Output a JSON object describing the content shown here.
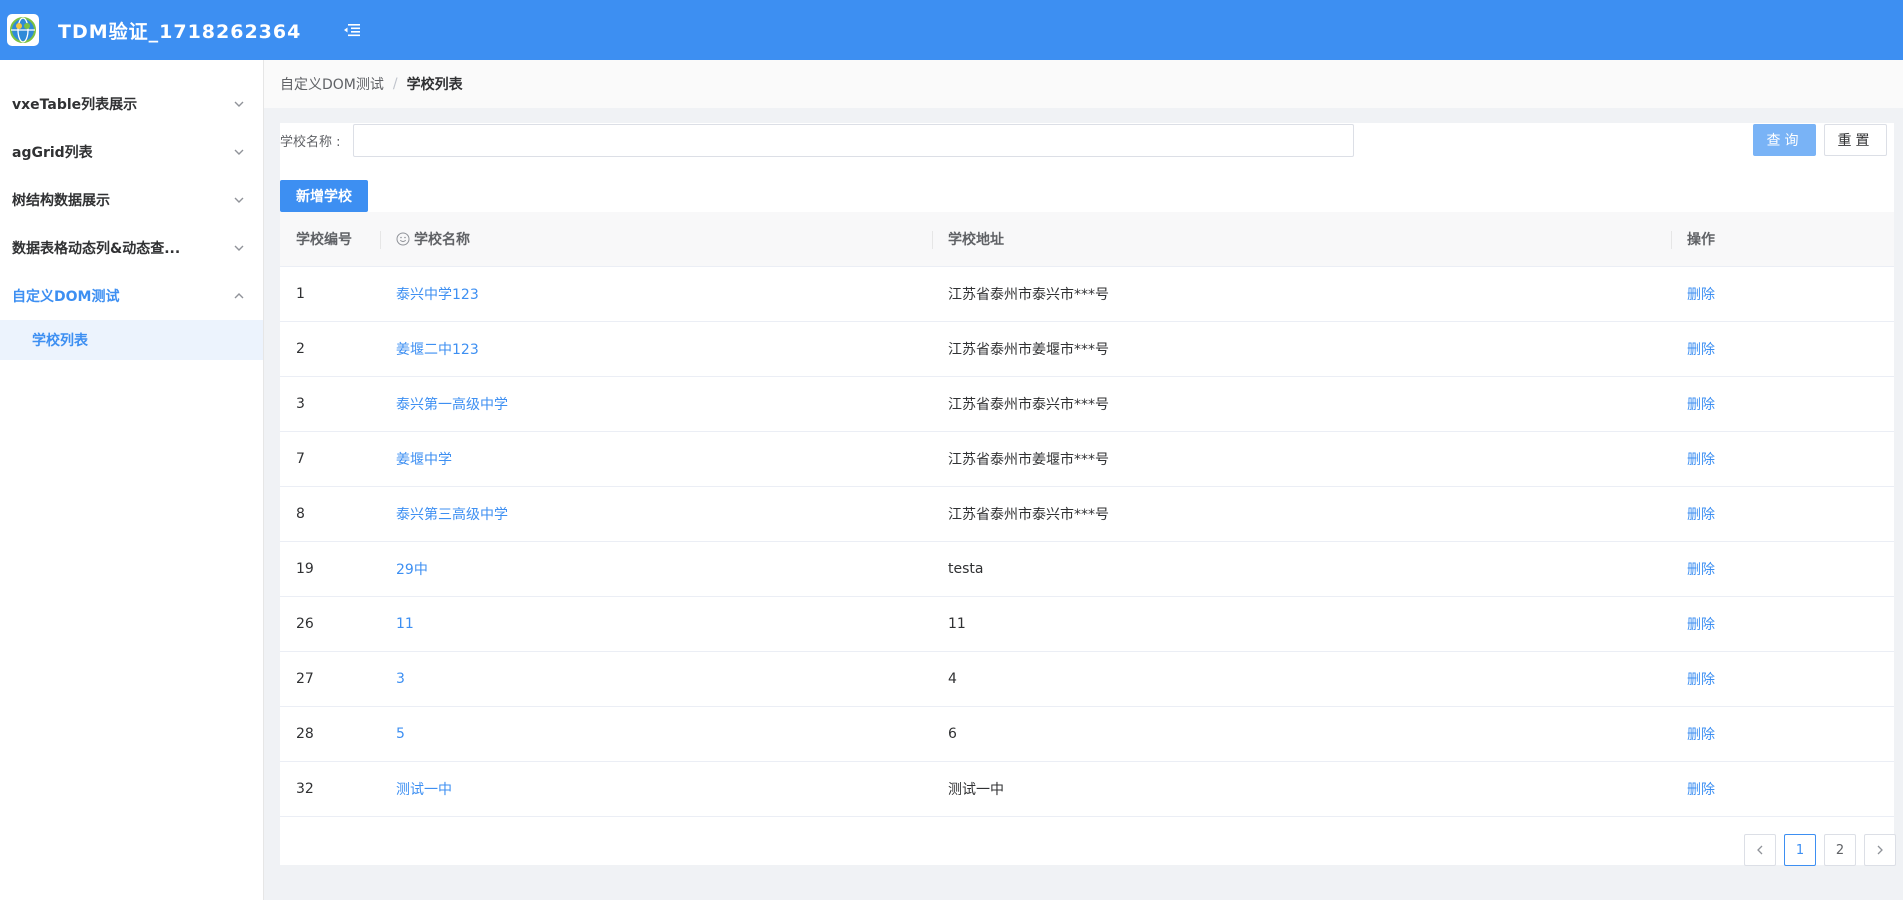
{
  "header": {
    "title": "TDM验证_1718262364",
    "logo_icon": "globe-logo-icon",
    "collapse_icon": "menu-fold-icon",
    "bg_color": "#3d8ff2"
  },
  "sidebar": {
    "items": [
      {
        "label": "vxeTable列表展示",
        "expanded": false
      },
      {
        "label": "agGrid列表",
        "expanded": false
      },
      {
        "label": "树结构数据展示",
        "expanded": false
      },
      {
        "label": "数据表格动态列&动态查...",
        "expanded": false
      },
      {
        "label": "自定义DOM测试",
        "expanded": true,
        "active": true
      }
    ],
    "submenu": [
      {
        "label": "学校列表",
        "active": true
      }
    ]
  },
  "breadcrumb": {
    "parent": "自定义DOM测试",
    "separator": "/",
    "current": "学校列表"
  },
  "search": {
    "label": "学校名称 :",
    "value": "",
    "placeholder": "",
    "query_label": "查询",
    "reset_label": "重置"
  },
  "actions": {
    "add_label": "新增学校"
  },
  "table": {
    "columns": [
      "学校编号",
      "学校名称",
      "学校地址",
      "操作"
    ],
    "rows": [
      {
        "id": "1",
        "name": "泰兴中学123",
        "address": "江苏省泰州市泰兴市***号",
        "action": "删除"
      },
      {
        "id": "2",
        "name": "姜堰二中123",
        "address": "江苏省泰州市姜堰市***号",
        "action": "删除"
      },
      {
        "id": "3",
        "name": "泰兴第一高级中学",
        "address": "江苏省泰州市泰兴市***号",
        "action": "删除"
      },
      {
        "id": "7",
        "name": "姜堰中学",
        "address": "江苏省泰州市姜堰市***号",
        "action": "删除"
      },
      {
        "id": "8",
        "name": "泰兴第三高级中学",
        "address": "江苏省泰州市泰兴市***号",
        "action": "删除"
      },
      {
        "id": "19",
        "name": "29中",
        "address": "testa",
        "action": "删除"
      },
      {
        "id": "26",
        "name": "11",
        "address": "11",
        "action": "删除"
      },
      {
        "id": "27",
        "name": "3",
        "address": "4",
        "action": "删除"
      },
      {
        "id": "28",
        "name": "5",
        "address": "6",
        "action": "删除"
      },
      {
        "id": "32",
        "name": "测试一中",
        "address": "测试一中",
        "action": "删除"
      }
    ]
  },
  "pagination": {
    "prev_icon": "chevron-left-icon",
    "pages": [
      "1",
      "2"
    ],
    "current": "1",
    "next_icon": "chevron-right-icon"
  }
}
